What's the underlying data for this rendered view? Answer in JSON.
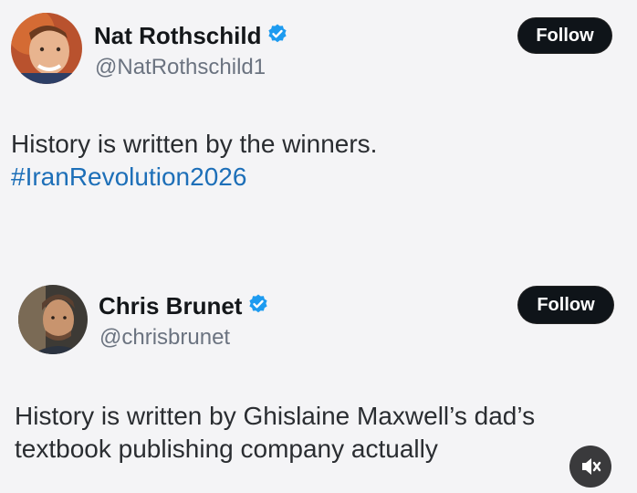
{
  "posts": [
    {
      "name": "Nat Rothschild",
      "handle": "@NatRothschild1",
      "follow_label": "Follow",
      "text_line1": "History is written by the winners.",
      "hashtag": "#IranRevolution2026"
    },
    {
      "name": "Chris Brunet",
      "handle": "@chrisbrunet",
      "follow_label": "Follow",
      "text_line1": "History is written by Ghislaine Maxwell’s dad’s",
      "text_line2": "textbook publishing company actually"
    }
  ],
  "icons": {
    "verified": "verified-badge-icon",
    "mute": "muted-speaker-icon"
  },
  "colors": {
    "verified_blue": "#1d9bf0",
    "hashtag_blue": "#1d6fb8",
    "follow_bg": "#0f1419"
  }
}
